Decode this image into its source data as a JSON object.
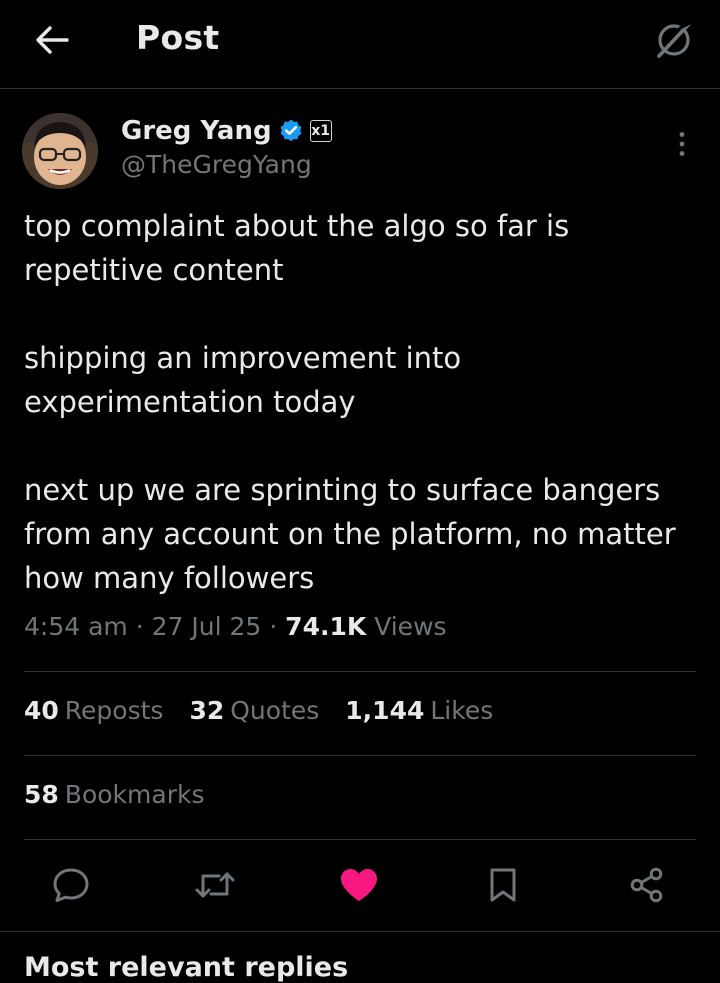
{
  "header": {
    "title": "Post",
    "back_icon": "arrow-left-icon",
    "grok_icon": "grok-icon"
  },
  "author": {
    "name": "Greg Yang",
    "handle": "@TheGregYang",
    "verified": true,
    "verified_color": "#1d9bf0",
    "affiliation_badge": "x1",
    "avatar_icon": "avatar-photo"
  },
  "post": {
    "paragraphs": [
      "top complaint about the algo so far is repetitive content",
      "shipping an improvement into experimentation today",
      "next up we are sprinting to surface bangers from any account on the platform, no matter how many followers"
    ],
    "time": "4:54 am",
    "date": "27 Jul 25",
    "views_count": "74.1K",
    "views_label": "Views",
    "separator": "·"
  },
  "stats": {
    "reposts": {
      "count": "40",
      "label": "Reposts"
    },
    "quotes": {
      "count": "32",
      "label": "Quotes"
    },
    "likes": {
      "count": "1,144",
      "label": "Likes"
    },
    "bookmarks": {
      "count": "58",
      "label": "Bookmarks"
    }
  },
  "actions": {
    "reply_icon": "reply-icon",
    "repost_icon": "repost-icon",
    "like_icon": "heart-icon",
    "like_color": "#f91880",
    "liked": true,
    "bookmark_icon": "bookmark-icon",
    "share_icon": "share-icon"
  },
  "replies": {
    "heading": "Most relevant replies"
  },
  "colors": {
    "background": "#000000",
    "text_primary": "#e7e9ea",
    "text_secondary": "#71767b",
    "divider": "#2f3336"
  }
}
